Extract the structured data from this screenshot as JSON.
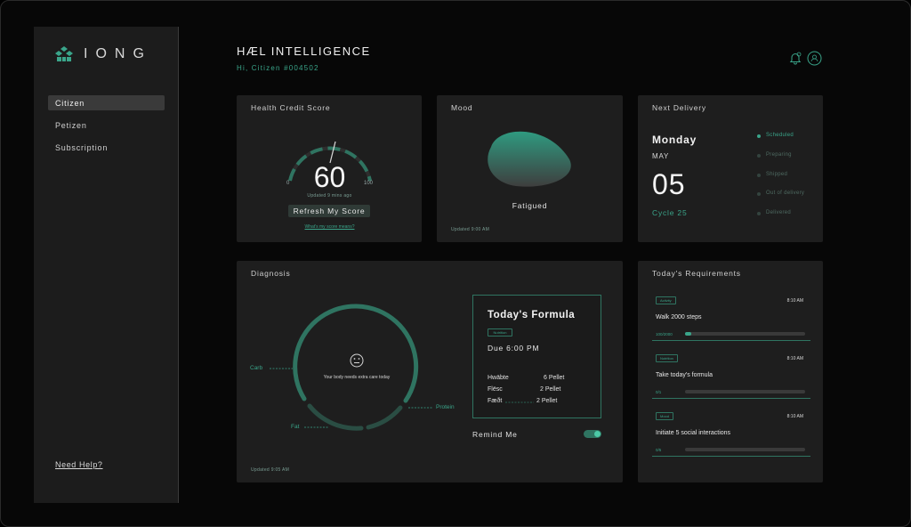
{
  "brand": {
    "logo_text": "IONG"
  },
  "sidebar": {
    "items": [
      {
        "label": "Citizen",
        "active": true
      },
      {
        "label": "Petizen",
        "active": false
      },
      {
        "label": "Subscription",
        "active": false
      }
    ],
    "help_label": "Need Help?"
  },
  "header": {
    "title": "HÆL INTELLIGENCE",
    "greeting": "Hi, Citizen #004502",
    "notification_icon": "bell-icon",
    "profile_icon": "profile-icon"
  },
  "health": {
    "title": "Health Credit Score",
    "score": "60",
    "score_value": 60,
    "min": "0",
    "max": "100",
    "updated": "Updated 9 mins ago",
    "refresh_label": "Refresh My Score",
    "link": "What's my score means?"
  },
  "mood": {
    "title": "Mood",
    "label": "Fatigued",
    "updated": "Updated 9:00 AM"
  },
  "delivery": {
    "title": "Next Delivery",
    "day": "Monday",
    "month": "MAY",
    "date": "05",
    "cycle": "Cycle 25",
    "statuses": [
      {
        "label": "Scheduled",
        "active": true
      },
      {
        "label": "Preparing",
        "active": false
      },
      {
        "label": "Shipped",
        "active": false
      },
      {
        "label": "Out of delivery",
        "active": false
      },
      {
        "label": "Delivered",
        "active": false
      }
    ]
  },
  "diagnosis": {
    "title": "Diagnosis",
    "message": "Your body needs extra care today",
    "face_icon": "neutral-face-icon",
    "macros": {
      "carb": "Carb",
      "protein": "Protein",
      "fat": "Fat"
    },
    "updated": "Updated 9:05 AM",
    "formula": {
      "title": "Today's Formula",
      "tag": "Nutrition",
      "due": "Due 6:00 PM",
      "items": [
        {
          "name": "Hwäbte",
          "qty": "6 Pellet"
        },
        {
          "name": "Flësc",
          "qty": "2 Pellet"
        },
        {
          "name": "Fæðt",
          "qty": "2 Pellet"
        }
      ]
    },
    "remind_label": "Remind Me",
    "remind_on": true
  },
  "requirements": {
    "title": "Today's Requirements",
    "items": [
      {
        "tag": "Activity",
        "time": "8:10 AM",
        "task": "Walk 2000 steps",
        "progress_label": "100/2000",
        "progress": 0.05
      },
      {
        "tag": "Nutrition",
        "time": "8:10 AM",
        "task": "Take today's formula",
        "progress_label": "0/1",
        "progress": 0
      },
      {
        "tag": "Mood",
        "time": "8:10 AM",
        "task": "Initiate 5 social interactions",
        "progress_label": "0/5",
        "progress": 0
      }
    ]
  },
  "colors": {
    "accent": "#3aa58a",
    "card": "#1e1e1e",
    "sidebar": "#1c1c1c"
  }
}
